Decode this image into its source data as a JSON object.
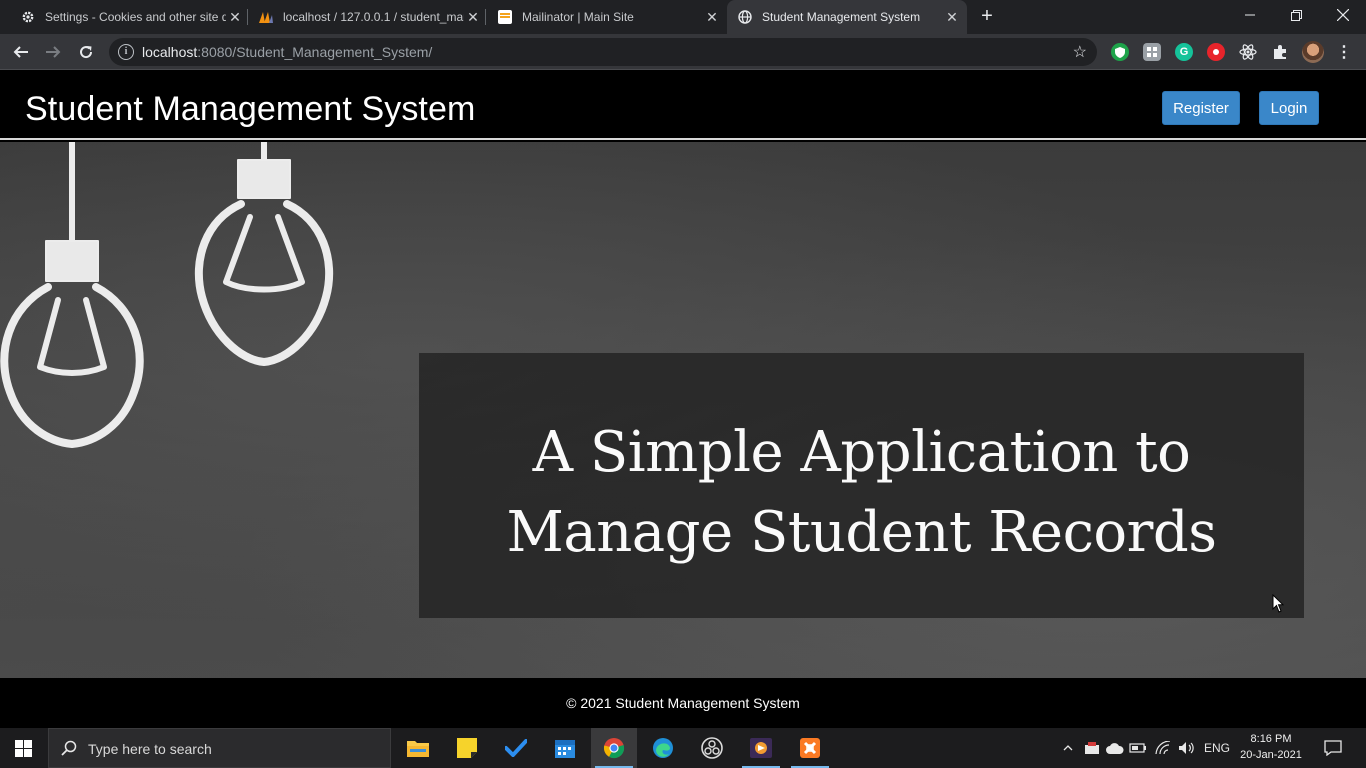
{
  "browser": {
    "tabs": [
      {
        "title": "Settings - Cookies and other site data",
        "icon": "gear-icon"
      },
      {
        "title": "localhost / 127.0.0.1 / student_management",
        "icon": "phpmyadmin-icon"
      },
      {
        "title": "Mailinator | Main Site",
        "icon": "mailinator-icon"
      },
      {
        "title": "Student Management System",
        "icon": "globe-icon",
        "active": true
      }
    ],
    "url_host": "localhost",
    "url_rest": ":8080/Student_Management_System/"
  },
  "header": {
    "title": "Student Management System",
    "register_label": "Register",
    "login_label": "Login"
  },
  "hero": {
    "tagline_line1": "A Simple Application to",
    "tagline_line2": "Manage Student Records"
  },
  "footer": {
    "text": "© 2021 Student Management System"
  },
  "taskbar": {
    "search_placeholder": "Type here to search",
    "language": "ENG",
    "time": "8:16 PM",
    "date": "20-Jan-2021"
  },
  "colors": {
    "accent_button": "#3a87c9",
    "header_bg": "#000000",
    "chalkboard": "#444444"
  }
}
